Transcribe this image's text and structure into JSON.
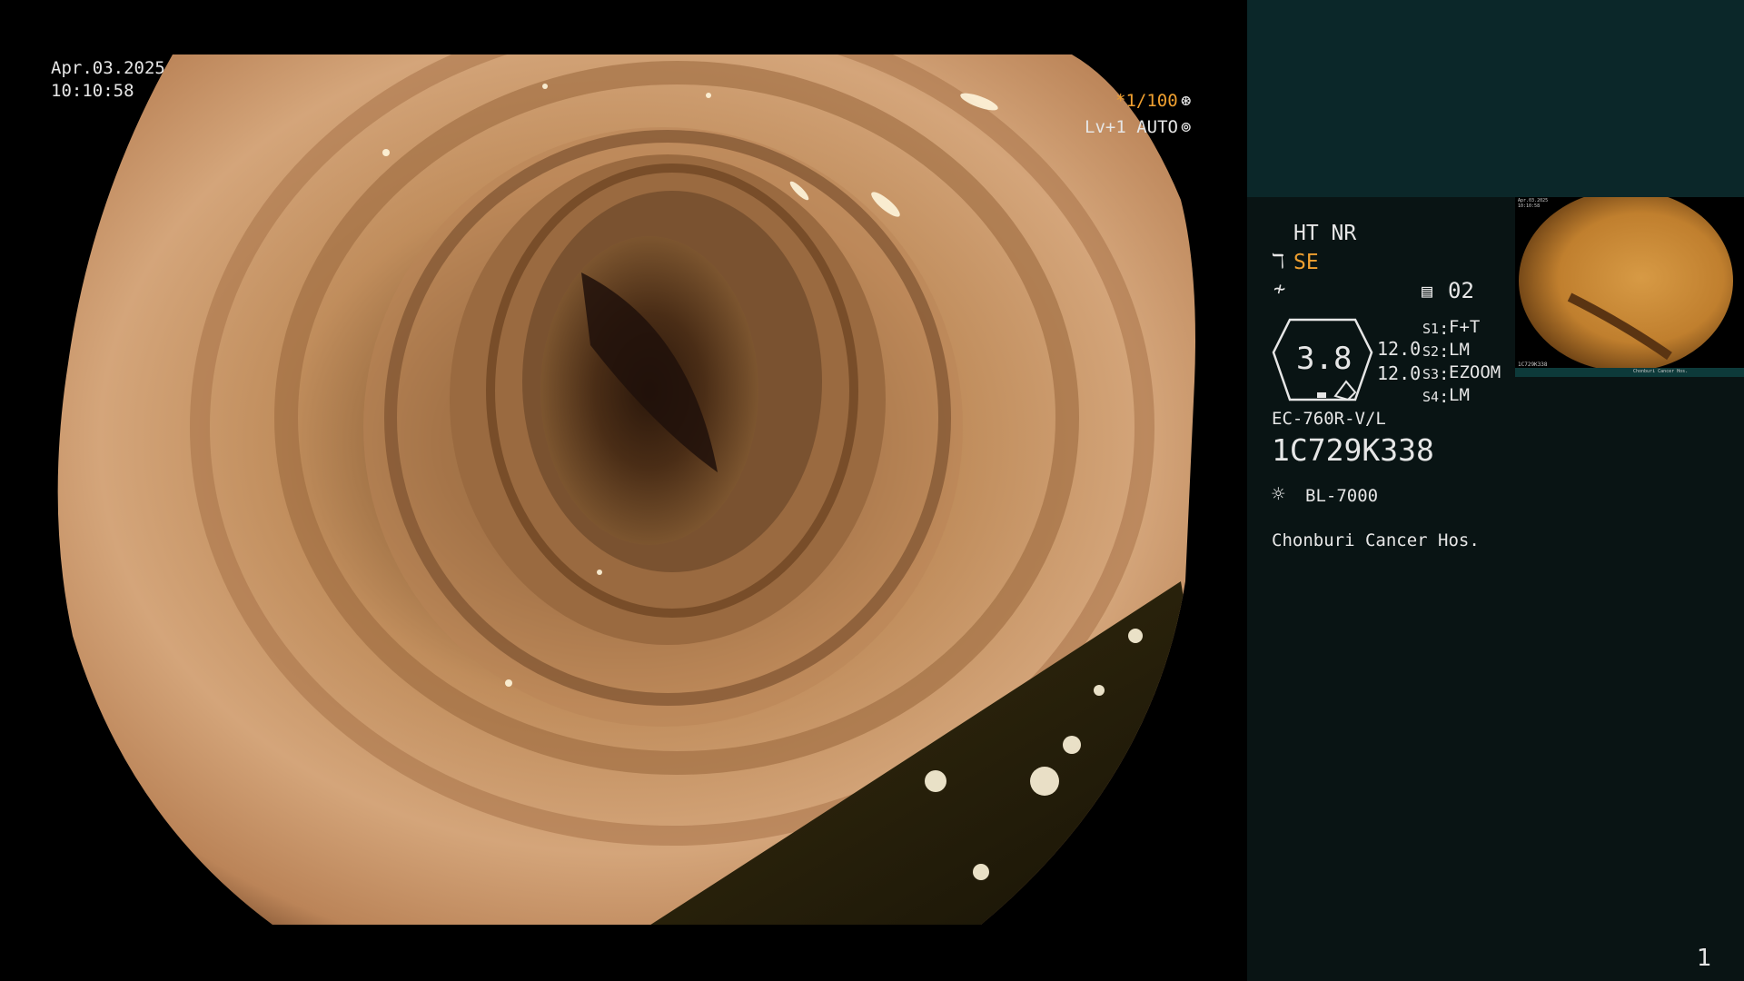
{
  "osd": {
    "date": "Apr.03.2025",
    "time": "10:10:58",
    "shutter": "*1/100",
    "shutter_icon": "shutter-icon",
    "iris": "Lv+1 AUTO",
    "iris_icon": "iris-icon"
  },
  "panel": {
    "enhance": "HT NR",
    "structure_mode": "SE",
    "structure_icon": "structure-enhance-icon",
    "color_icon": "color-mode-icon",
    "memory_icon": "memory-icon",
    "memory_number": "02",
    "zoom_value": "3.8",
    "zoom_sub_values": [
      "12.0",
      "12.0"
    ],
    "switches": [
      {
        "key": "S1",
        "value": "F+T"
      },
      {
        "key": "S2",
        "value": "LM"
      },
      {
        "key": "S3",
        "value": "EZOOM"
      },
      {
        "key": "S4",
        "value": "LM"
      }
    ],
    "scope_model": "EC-760R-V/L",
    "serial": "1C729K338",
    "light_icon": "light-source-icon",
    "light_source": "BL-7000",
    "hospital": "Chonburi Cancer Hos.",
    "page_number": "1"
  },
  "thumbnail": {
    "date": "Apr.03.2025",
    "time": "10:10:58",
    "serial": "1C729K338",
    "hospital": "Chonburi Cancer Hos."
  },
  "colors": {
    "accent": "#f0a030",
    "panel_top": "#0b2729",
    "panel_bottom": "#091414",
    "text": "#e6e6e6"
  }
}
